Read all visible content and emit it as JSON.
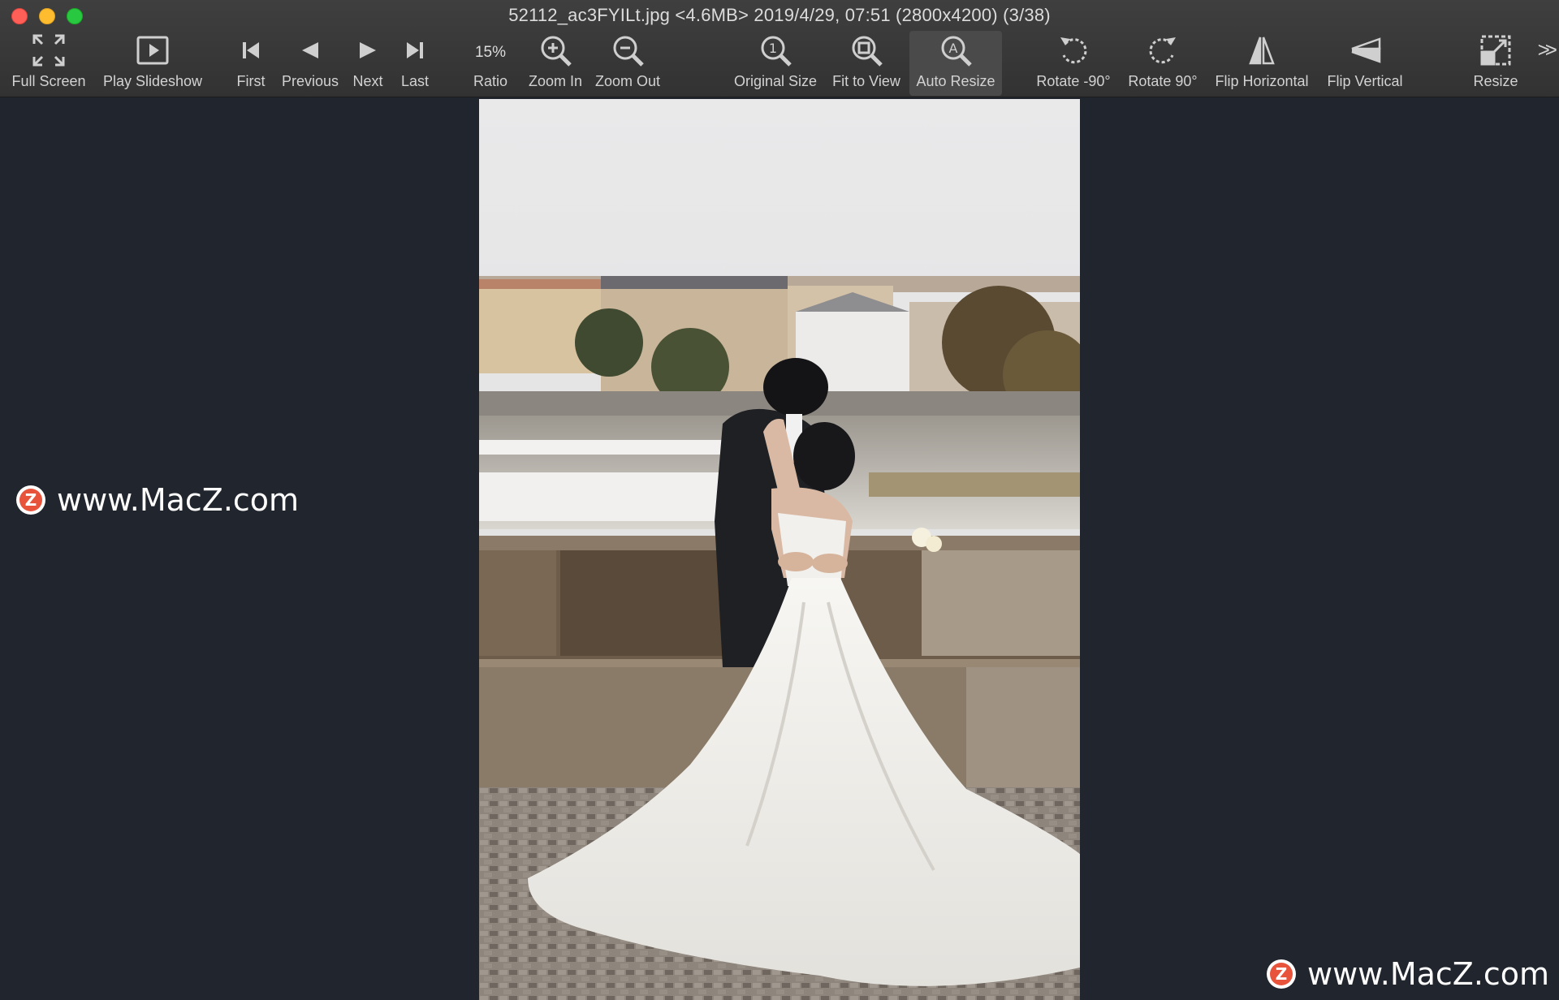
{
  "window": {
    "title": "52112_ac3FYILt.jpg <4.6MB> 2019/4/29, 07:51 (2800x4200) (3/38)"
  },
  "toolbar": {
    "full_screen": "Full Screen",
    "play_slideshow": "Play Slideshow",
    "first": "First",
    "previous": "Previous",
    "next": "Next",
    "last": "Last",
    "ratio_value": "15%",
    "ratio": "Ratio",
    "zoom_in": "Zoom In",
    "zoom_out": "Zoom Out",
    "original_size": "Original Size",
    "fit_to_view": "Fit to View",
    "auto_resize": "Auto Resize",
    "rotate_left": "Rotate -90°",
    "rotate_right": "Rotate 90°",
    "flip_horizontal": "Flip Horizontal",
    "flip_vertical": "Flip Vertical",
    "resize": "Resize",
    "active_tool": "Auto Resize"
  },
  "watermarks": {
    "left": "www.MacZ.com",
    "bottom_right": "www.MacZ.com",
    "badge_letter": "Z"
  },
  "icons": {
    "full_screen": "expand-arrows-icon",
    "play_slideshow": "play-square-icon",
    "first": "skip-first-icon",
    "previous": "triangle-left-icon",
    "next": "triangle-right-icon",
    "last": "skip-last-icon",
    "zoom_in": "magnifier-plus-icon",
    "zoom_out": "magnifier-minus-icon",
    "original_size": "magnifier-one-icon",
    "fit_to_view": "magnifier-square-icon",
    "auto_resize": "magnifier-a-icon",
    "rotate_left": "rotate-ccw-icon",
    "rotate_right": "rotate-cw-icon",
    "flip_horizontal": "flip-horizontal-icon",
    "flip_vertical": "flip-vertical-icon",
    "resize": "resize-icon",
    "overflow": "double-chevron-icon"
  },
  "colors": {
    "background": "#21252d",
    "toolbar": "#383838",
    "toolbar_text": "#d2d2d2",
    "watermark_badge": "#e8533c"
  }
}
